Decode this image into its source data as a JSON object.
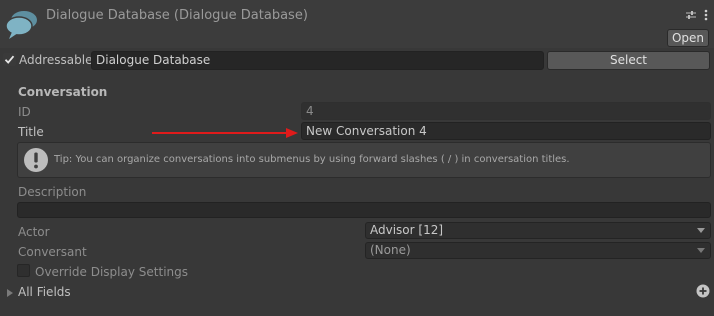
{
  "header": {
    "title": "Dialogue Database (Dialogue Database)",
    "open_label": "Open",
    "icons": [
      "chat-bubbles-icon",
      "sliders-icon",
      "kebab-menu-icon"
    ]
  },
  "addressable": {
    "checked": true,
    "label": "Addressable",
    "value": "Dialogue Database",
    "select_label": "Select"
  },
  "conversation": {
    "section_label": "Conversation",
    "id_label": "ID",
    "id_value": "4",
    "title_label": "Title",
    "title_value": "New Conversation 4",
    "tip_text": "Tip: You can organize conversations into submenus by using forward slashes ( / ) in conversation titles.",
    "description_label": "Description",
    "description_value": "",
    "actor_label": "Actor",
    "actor_value": "Advisor [12]",
    "conversant_label": "Conversant",
    "conversant_value": "(None)",
    "override_label": "Override Display Settings",
    "override_checked": false,
    "all_fields_label": "All Fields"
  },
  "colors": {
    "annotation_arrow": "#e01b1b",
    "background": "#383838"
  }
}
